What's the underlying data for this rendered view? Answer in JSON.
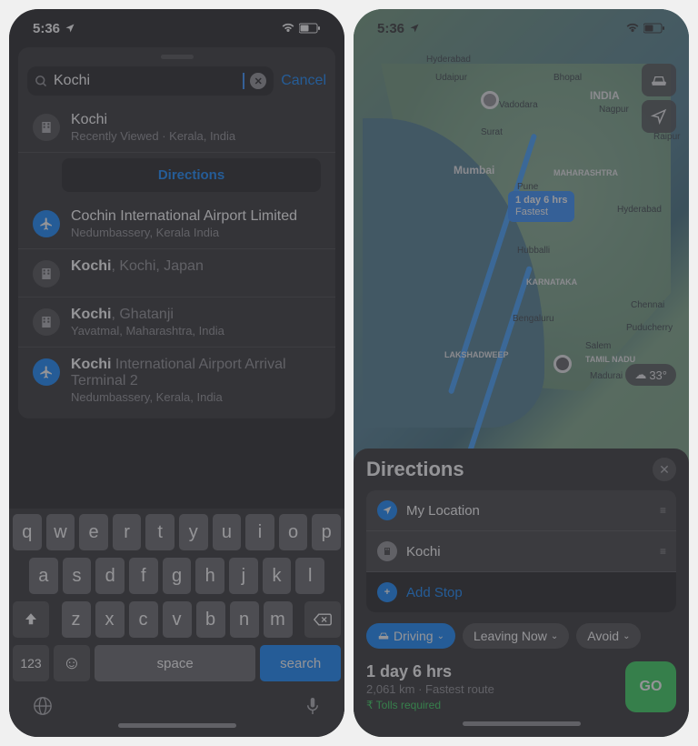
{
  "left": {
    "status": {
      "time": "5:36",
      "wifi": true,
      "battery": 50
    },
    "search": {
      "value": "Kochi",
      "cancel": "Cancel"
    },
    "results": [
      {
        "title": "Kochi",
        "sub": "Recently Viewed · Kerala, India",
        "icon": "building",
        "directions": "Directions"
      },
      {
        "title": "Cochin International Airport Limited",
        "sub": "Nedumbassery, Kerala India",
        "icon": "plane"
      },
      {
        "title_bold": "Kochi",
        "title_rest": ", Kochi, Japan",
        "sub": "",
        "icon": "building"
      },
      {
        "title_bold": "Kochi",
        "title_rest": ", Ghatanji",
        "sub": "Yavatmal, Maharashtra, India",
        "icon": "building"
      },
      {
        "title_bold": "Kochi",
        "title_rest": " International Airport Arrival Terminal 2",
        "sub": "Nedumbassery, Kerala, India",
        "icon": "plane"
      }
    ],
    "keyboard": {
      "row1": [
        "q",
        "w",
        "e",
        "r",
        "t",
        "y",
        "u",
        "i",
        "o",
        "p"
      ],
      "row2": [
        "a",
        "s",
        "d",
        "f",
        "g",
        "h",
        "j",
        "k",
        "l"
      ],
      "row3": [
        "z",
        "x",
        "c",
        "v",
        "b",
        "n",
        "m"
      ],
      "num": "123",
      "space": "space",
      "search": "search"
    }
  },
  "right": {
    "status": {
      "time": "5:36",
      "wifi": true,
      "battery": 50
    },
    "map_labels": {
      "hyderabad_top": "Hyderabad",
      "udaipur": "Udaipur",
      "bhopal": "Bhopal",
      "india": "INDIA",
      "vadodara": "Vadodara",
      "nagpur": "Nagpur",
      "raipur": "Raipur",
      "surat": "Surat",
      "mumbai": "Mumbai",
      "pune": "Pune",
      "maharashtra": "MAHARASHTRA",
      "hyderabad": "Hyderabad",
      "hubballi": "Hubballi",
      "karnataka": "KARNATAKA",
      "bengaluru": "Bengaluru",
      "chennai": "Chennai",
      "puducherry": "Puducherry",
      "lakshadweep": "LAKSHADWEEP",
      "salem": "Salem",
      "tamilnadu": "TAMIL NADU",
      "madurai": "Madurai"
    },
    "eta": {
      "duration": "1 day 6 hrs",
      "tag": "Fastest"
    },
    "weather": "33°",
    "sheet": {
      "title": "Directions",
      "stops": [
        {
          "label": "My Location",
          "icon": "loc"
        },
        {
          "label": "Kochi",
          "icon": "dest"
        }
      ],
      "add_stop": "Add Stop",
      "chips": {
        "mode": "Driving",
        "when": "Leaving Now",
        "avoid": "Avoid"
      },
      "summary": {
        "duration": "1 day 6 hrs",
        "distance": "2,061 km · Fastest route",
        "tolls": "Tolls required",
        "go": "GO"
      }
    }
  }
}
